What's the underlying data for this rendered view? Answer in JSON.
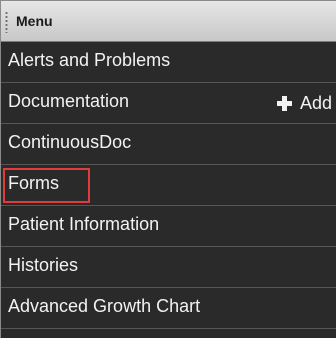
{
  "menu": {
    "title": "Menu",
    "items": [
      {
        "label": "Alerts and Problems"
      },
      {
        "label": "Documentation",
        "action_label": "Add",
        "action_icon": "plus-icon"
      },
      {
        "label": "ContinuousDoc"
      },
      {
        "label": "Forms",
        "highlighted": true
      },
      {
        "label": "Patient Information"
      },
      {
        "label": "Histories"
      },
      {
        "label": "Advanced Growth Chart"
      }
    ]
  },
  "colors": {
    "header_bg": "#d6d6d6",
    "list_bg": "#2a2a2a",
    "text": "#f2f2f2",
    "highlight": "#e23b3b"
  }
}
